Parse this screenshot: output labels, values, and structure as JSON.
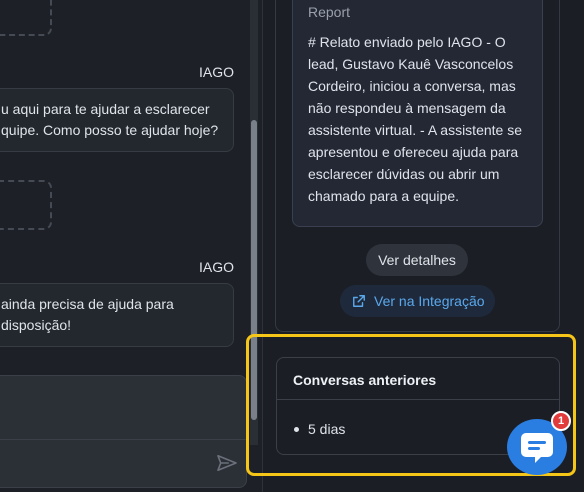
{
  "chat": {
    "messages": [
      {
        "sender": "IAGO",
        "lines": [
          "u aqui para te ajudar a esclarecer",
          "quipe. Como posso te ajudar hoje?"
        ]
      },
      {
        "sender": "IAGO",
        "lines": [
          "ainda precisa de ajuda para",
          "disposição!"
        ]
      }
    ]
  },
  "report": {
    "label": "Report",
    "lines": [
      "# Relato enviado pelo IAGO - O",
      "lead, Gustavo Kauê Vasconcelos",
      "Cordeiro, iniciou a conversa, mas",
      "não respondeu à mensagem da",
      "assistente virtual. - A assistente se",
      "apresentou e ofereceu ajuda para",
      "esclarecer dúvidas ou abrir um",
      "chamado para a equipe."
    ]
  },
  "actions": {
    "details_label": "Ver detalhes",
    "integration_label": "Ver na Integração"
  },
  "previous_conversations": {
    "title": "Conversas anteriores",
    "items": [
      "5 dias"
    ]
  },
  "widget": {
    "badge_count": "1"
  },
  "colors": {
    "accent": "#5aa8ec",
    "fab": "#2a7de1",
    "highlight": "#f5c518",
    "badge": "#e23b3b"
  }
}
